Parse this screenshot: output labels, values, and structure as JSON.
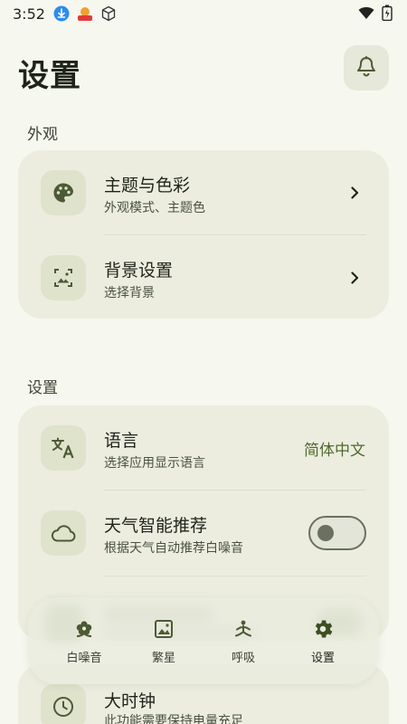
{
  "status_bar": {
    "time": "3:52",
    "icons": [
      "download-icon",
      "app-badge-icon",
      "cube-icon",
      "wifi-icon",
      "battery-icon"
    ]
  },
  "header": {
    "title": "设置",
    "action_icon": "bell-icon"
  },
  "sections": {
    "appearance": {
      "label": "外观",
      "items": [
        {
          "icon": "palette-icon",
          "title": "主题与色彩",
          "subtitle": "外观模式、主题色"
        },
        {
          "icon": "image-icon",
          "title": "背景设置",
          "subtitle": "选择背景"
        }
      ]
    },
    "settings": {
      "label": "设置",
      "items": [
        {
          "icon": "translate-icon",
          "title": "语言",
          "subtitle": "选择应用显示语言",
          "value": "简体中文"
        },
        {
          "icon": "cloud-icon",
          "title": "天气智能推荐",
          "subtitle": "根据天气自动推荐白噪音",
          "toggle": false
        },
        {
          "icon": "clock-icon",
          "title": "大时钟",
          "subtitle": "此功能需要保持电量充足"
        }
      ]
    }
  },
  "bottom_nav": {
    "items": [
      {
        "icon": "flower-icon",
        "label": "白噪音",
        "active": false
      },
      {
        "icon": "photo-icon",
        "label": "繁星",
        "active": false
      },
      {
        "icon": "meditation-icon",
        "label": "呼吸",
        "active": false
      },
      {
        "icon": "gear-icon",
        "label": "设置",
        "active": true
      }
    ]
  },
  "colors": {
    "background": "#f6f7ef",
    "card": "#eceddf",
    "accent": "#4f6a2e",
    "icon": "#4c5a35"
  }
}
